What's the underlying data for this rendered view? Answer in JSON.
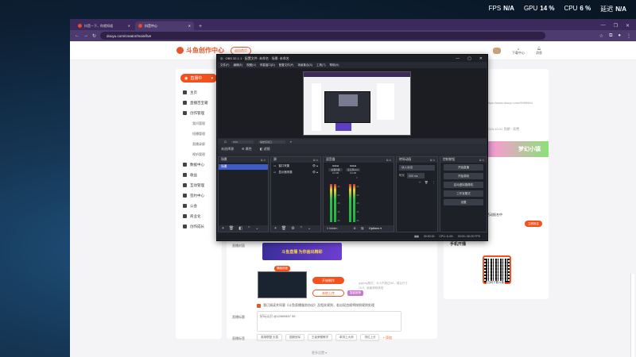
{
  "overlay": {
    "fps_label": "FPS",
    "fps_value": "N/A",
    "gpu_label": "GPU",
    "gpu_value": "14 %",
    "cpu_label": "CPU",
    "cpu_value": "6 %",
    "latency_label": "延迟",
    "latency_value": "N/A"
  },
  "browser": {
    "tabs": [
      {
        "title": "抖音一下，你就知道"
      },
      {
        "title": "抖音中心"
      }
    ],
    "url": "douyu.com/creator/main/live",
    "window_controls": [
      "—",
      "❐",
      "✕"
    ]
  },
  "site": {
    "logo": "斗鱼创作中心",
    "home_button": "返回首页",
    "header_icons": [
      {
        "label": "下载中心"
      },
      {
        "label": "消息"
      }
    ],
    "live_button": "直播中",
    "sidebar": [
      {
        "label": "主页",
        "type": "item"
      },
      {
        "label": "直播百宝箱",
        "type": "item"
      },
      {
        "label": "创作管理",
        "type": "item"
      },
      {
        "label": "我问管理",
        "type": "sub"
      },
      {
        "label": "短播管理",
        "type": "sub"
      },
      {
        "label": "直播录屏",
        "type": "sub"
      },
      {
        "label": "视听管理",
        "type": "sub"
      },
      {
        "label": "数据中心",
        "type": "item"
      },
      {
        "label": "收益",
        "type": "item"
      },
      {
        "label": "互动管理",
        "type": "item"
      },
      {
        "label": "签约中心",
        "type": "item"
      },
      {
        "label": "公会",
        "type": "item"
      },
      {
        "label": "商业化",
        "type": "item"
      },
      {
        "label": "创作成长",
        "type": "item"
      }
    ],
    "cover_label": "直播封面",
    "banner_text": "斗鱼直播 为你画出精彩",
    "thumb_tag": "横版封面",
    "upload_button": "开始制作",
    "secondary_button": "本地上传",
    "pink_tag": "智能推荐",
    "hint": "jpg/png格式，大小不超过5M，建议尺寸16:9，画面清晰美观",
    "agree_text": "我已阅读并同意《斗鱼直播服务协议》及相关规则，若出现违规将按照规则处理",
    "title_label": "直播标题",
    "title_value": "好玩认识 @12809467 59",
    "tags_label": "直播标签",
    "tags": [
      "英雄联盟 无畏",
      "国服冠军",
      "王者荣耀教学",
      "单排上大师",
      "排位上分"
    ],
    "tag_add": "+ 添加",
    "more_link": "更多设置 ▾",
    "right_panel": {
      "link_text": "https://www.douyu.com/9059964",
      "note": "2024-10-01 到期 · 续费",
      "game_banner": "梦幻小镇",
      "promo": "活动报名中",
      "pill": "立即报名",
      "qr_title": "手机开播",
      "qr_label": "扫码下载斗鱼"
    }
  },
  "obs": {
    "title": "OBS 32.1.1 · 配置文件: 未命名 · 场景: 未命名",
    "menu": [
      "文件(F)",
      "编辑(E)",
      "视图(V)",
      "停靠窗口(D)",
      "配置文件(P)",
      "场景集合(S)",
      "工具(T)",
      "帮助(H)"
    ],
    "zoom": "15%",
    "scale_label": "缩放至窗口",
    "source_bar": {
      "no_source": "未选择源",
      "props": "属性",
      "filters": "滤镜"
    },
    "docks": {
      "scenes": {
        "title": "场景",
        "items": [
          "场景"
        ]
      },
      "sources": {
        "title": "源",
        "items": [
          "窗口采集",
          "显示器采集"
        ]
      },
      "mixer": {
        "title": "混音器",
        "channels": [
          {
            "name": "Global",
            "device": "桌面音频",
            "value": "0.0 dB"
          },
          {
            "name": "Global",
            "device": "麦克风/Aux",
            "value": "0.0 dB"
          }
        ],
        "footer": "0 hidden",
        "options": "Options"
      },
      "transitions": {
        "title": "转场动画",
        "type": "淡入淡出",
        "duration_label": "时长",
        "duration_value": "300 ms"
      },
      "controls": {
        "title": "控制按钮",
        "buttons": [
          "开始直播",
          "开始录制",
          "启动虚拟摄像机",
          "工作室模式",
          "设置"
        ]
      }
    },
    "status": {
      "cpu": "CPU: 6.4%",
      "fps": "00:00 / 60.00 FPS",
      "time": "00:00:00"
    }
  }
}
